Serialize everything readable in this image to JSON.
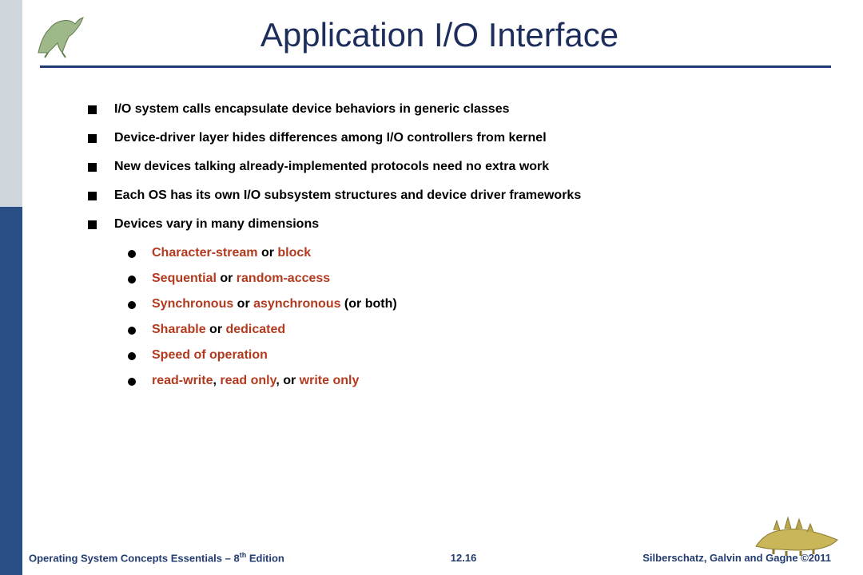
{
  "title": "Application I/O Interface",
  "bullets": {
    "b0": "I/O system calls encapsulate device behaviors in generic classes",
    "b1": "Device-driver layer hides differences among I/O controllers from kernel",
    "b2": "New devices talking already-implemented protocols need no extra work",
    "b3": "Each OS has its own I/O subsystem structures and device driver frameworks",
    "b4": "Devices vary in many dimensions"
  },
  "sub": {
    "s0a": "Character-stream",
    "s0b": " or ",
    "s0c": "block",
    "s1a": "Sequential",
    "s1b": " or ",
    "s1c": "random-access",
    "s2a": "Synchronous",
    "s2b": " or ",
    "s2c": "asynchronous",
    "s2d": " (or both)",
    "s3a": "Sharable",
    "s3b": " or ",
    "s3c": "dedicated",
    "s4a": "Speed of operation",
    "s5a": "read-write",
    "s5b": ", ",
    "s5c": "read only",
    "s5d": ", or ",
    "s5e": "write only"
  },
  "footer": {
    "left_a": "Operating System Concepts Essentials – 8",
    "left_sup": "th",
    "left_b": " Edition",
    "mid": "12.16",
    "right": "Silberschatz, Galvin and Gagne ©2011"
  }
}
